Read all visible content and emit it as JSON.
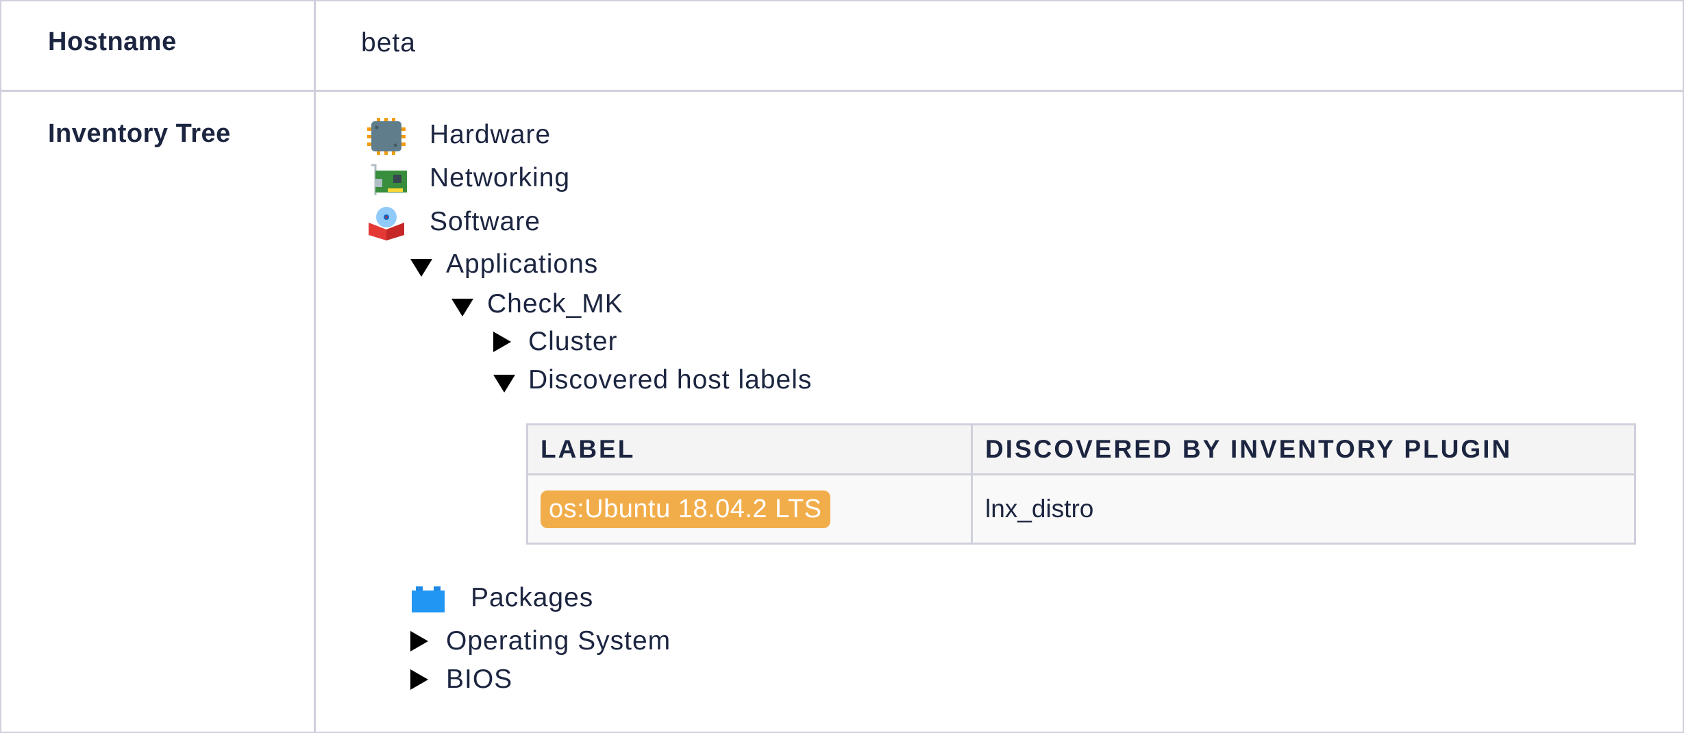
{
  "hostname": {
    "label": "Hostname",
    "value": "beta"
  },
  "inventory": {
    "label": "Inventory Tree",
    "nodes": {
      "hardware": {
        "label": "Hardware",
        "icon": "cpu-chip-icon"
      },
      "networking": {
        "label": "Networking",
        "icon": "network-card-icon"
      },
      "software": {
        "label": "Software",
        "icon": "software-box-icon"
      },
      "applications": {
        "label": "Applications",
        "state": "expanded"
      },
      "check_mk": {
        "label": "Check_MK",
        "state": "expanded"
      },
      "cluster": {
        "label": "Cluster",
        "state": "collapsed"
      },
      "discovered_host_labels": {
        "label": "Discovered host labels",
        "state": "expanded"
      },
      "packages": {
        "label": "Packages",
        "icon": "packages-icon"
      },
      "operating_system": {
        "label": "Operating System",
        "state": "collapsed"
      },
      "bios": {
        "label": "BIOS",
        "state": "collapsed"
      }
    },
    "labels_table": {
      "columns": [
        "LABEL",
        "DISCOVERED BY INVENTORY PLUGIN"
      ],
      "rows": [
        {
          "label": "os:Ubuntu 18.04.2 LTS",
          "plugin": "lnx_distro"
        }
      ]
    }
  },
  "colors": {
    "label_chip": "#f2ad4b",
    "border": "#cfd0dc",
    "text": "#1c2540"
  }
}
